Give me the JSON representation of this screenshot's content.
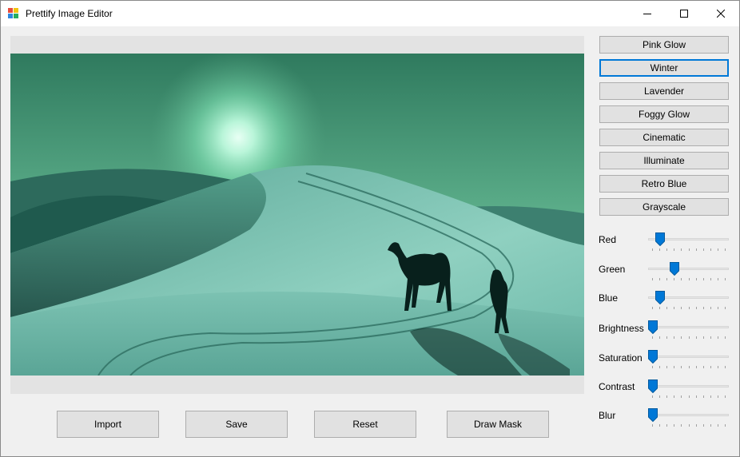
{
  "window": {
    "title": "Prettify Image Editor",
    "icons": {
      "app": "app-icon",
      "minimize": "minimize-icon",
      "maximize": "maximize-icon",
      "close": "close-icon"
    }
  },
  "preview": {
    "image": "desert-dunes-camel-silhouette-image"
  },
  "filters": [
    "Pink Glow",
    "Winter",
    "Lavender",
    "Foggy Glow",
    "Cinematic",
    "Illuminate",
    "Retro Blue",
    "Grayscale"
  ],
  "selected_filter": "Winter",
  "sliders": [
    {
      "label": "Red",
      "level": 0.1
    },
    {
      "label": "Green",
      "level": 0.3
    },
    {
      "label": "Blue",
      "level": 0.1
    },
    {
      "label": "Brightness",
      "level": 0
    },
    {
      "label": "Saturation",
      "level": 0
    },
    {
      "label": "Contrast",
      "level": 0
    },
    {
      "label": "Blur",
      "level": 0
    }
  ],
  "actions": {
    "import": "Import",
    "save": "Save",
    "reset": "Reset",
    "draw_mask": "Draw Mask"
  },
  "colors": {
    "accent": "#0078d7",
    "button_face": "#e1e1e1",
    "window_bg": "#f0f0f0"
  }
}
